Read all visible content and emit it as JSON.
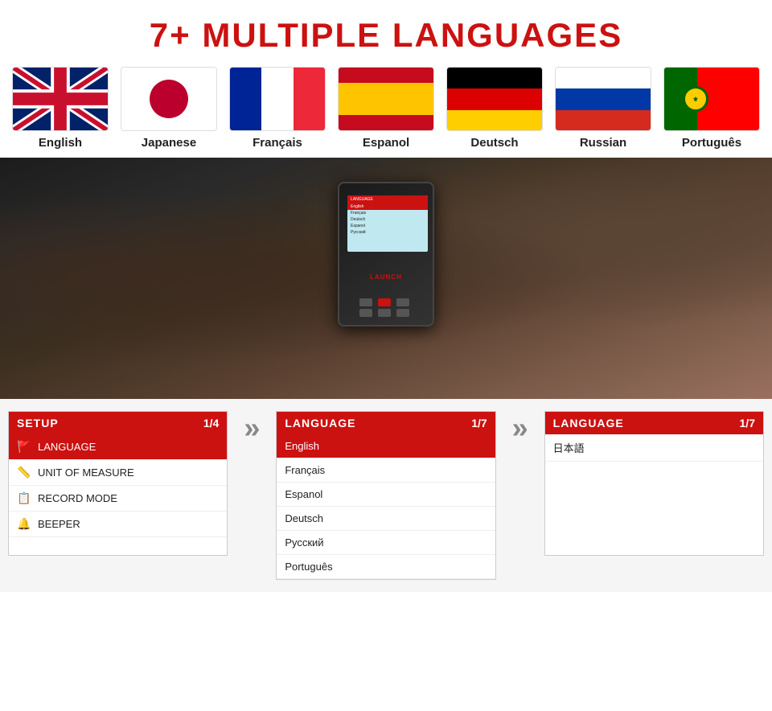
{
  "title": "7+ MULTIPLE LANGUAGES",
  "flags": [
    {
      "id": "english",
      "label": "English",
      "type": "uk"
    },
    {
      "id": "japanese",
      "label": "Japanese",
      "type": "japan"
    },
    {
      "id": "francais",
      "label": "Français",
      "type": "france"
    },
    {
      "id": "espanol",
      "label": "Espanol",
      "type": "spain"
    },
    {
      "id": "deutsch",
      "label": "Deutsch",
      "type": "germany"
    },
    {
      "id": "russian",
      "label": "Russian",
      "type": "russia"
    },
    {
      "id": "portugues",
      "label": "Português",
      "type": "portugal"
    }
  ],
  "panel1": {
    "title": "SETUP",
    "num": "1/4",
    "items": [
      {
        "icon": "🚩",
        "label": "LANGUAGE",
        "highlighted": true
      },
      {
        "icon": "📏",
        "label": "UNIT OF MEASURE",
        "highlighted": false
      },
      {
        "icon": "📋",
        "label": "RECORD MODE",
        "highlighted": false
      },
      {
        "icon": "🔔",
        "label": "BEEPER",
        "highlighted": false
      }
    ]
  },
  "panel2": {
    "title": "LANGUAGE",
    "num": "1/7",
    "items": [
      {
        "label": "English",
        "highlighted": true
      },
      {
        "label": "Français",
        "highlighted": false
      },
      {
        "label": "Espanol",
        "highlighted": false
      },
      {
        "label": "Deutsch",
        "highlighted": false
      },
      {
        "label": "Русский",
        "highlighted": false
      },
      {
        "label": "Português",
        "highlighted": false
      }
    ]
  },
  "panel3": {
    "title": "LANGUAGE",
    "num": "1/7",
    "items": [
      {
        "label": "日本語",
        "highlighted": false
      }
    ]
  },
  "arrows": {
    "char": "»"
  }
}
